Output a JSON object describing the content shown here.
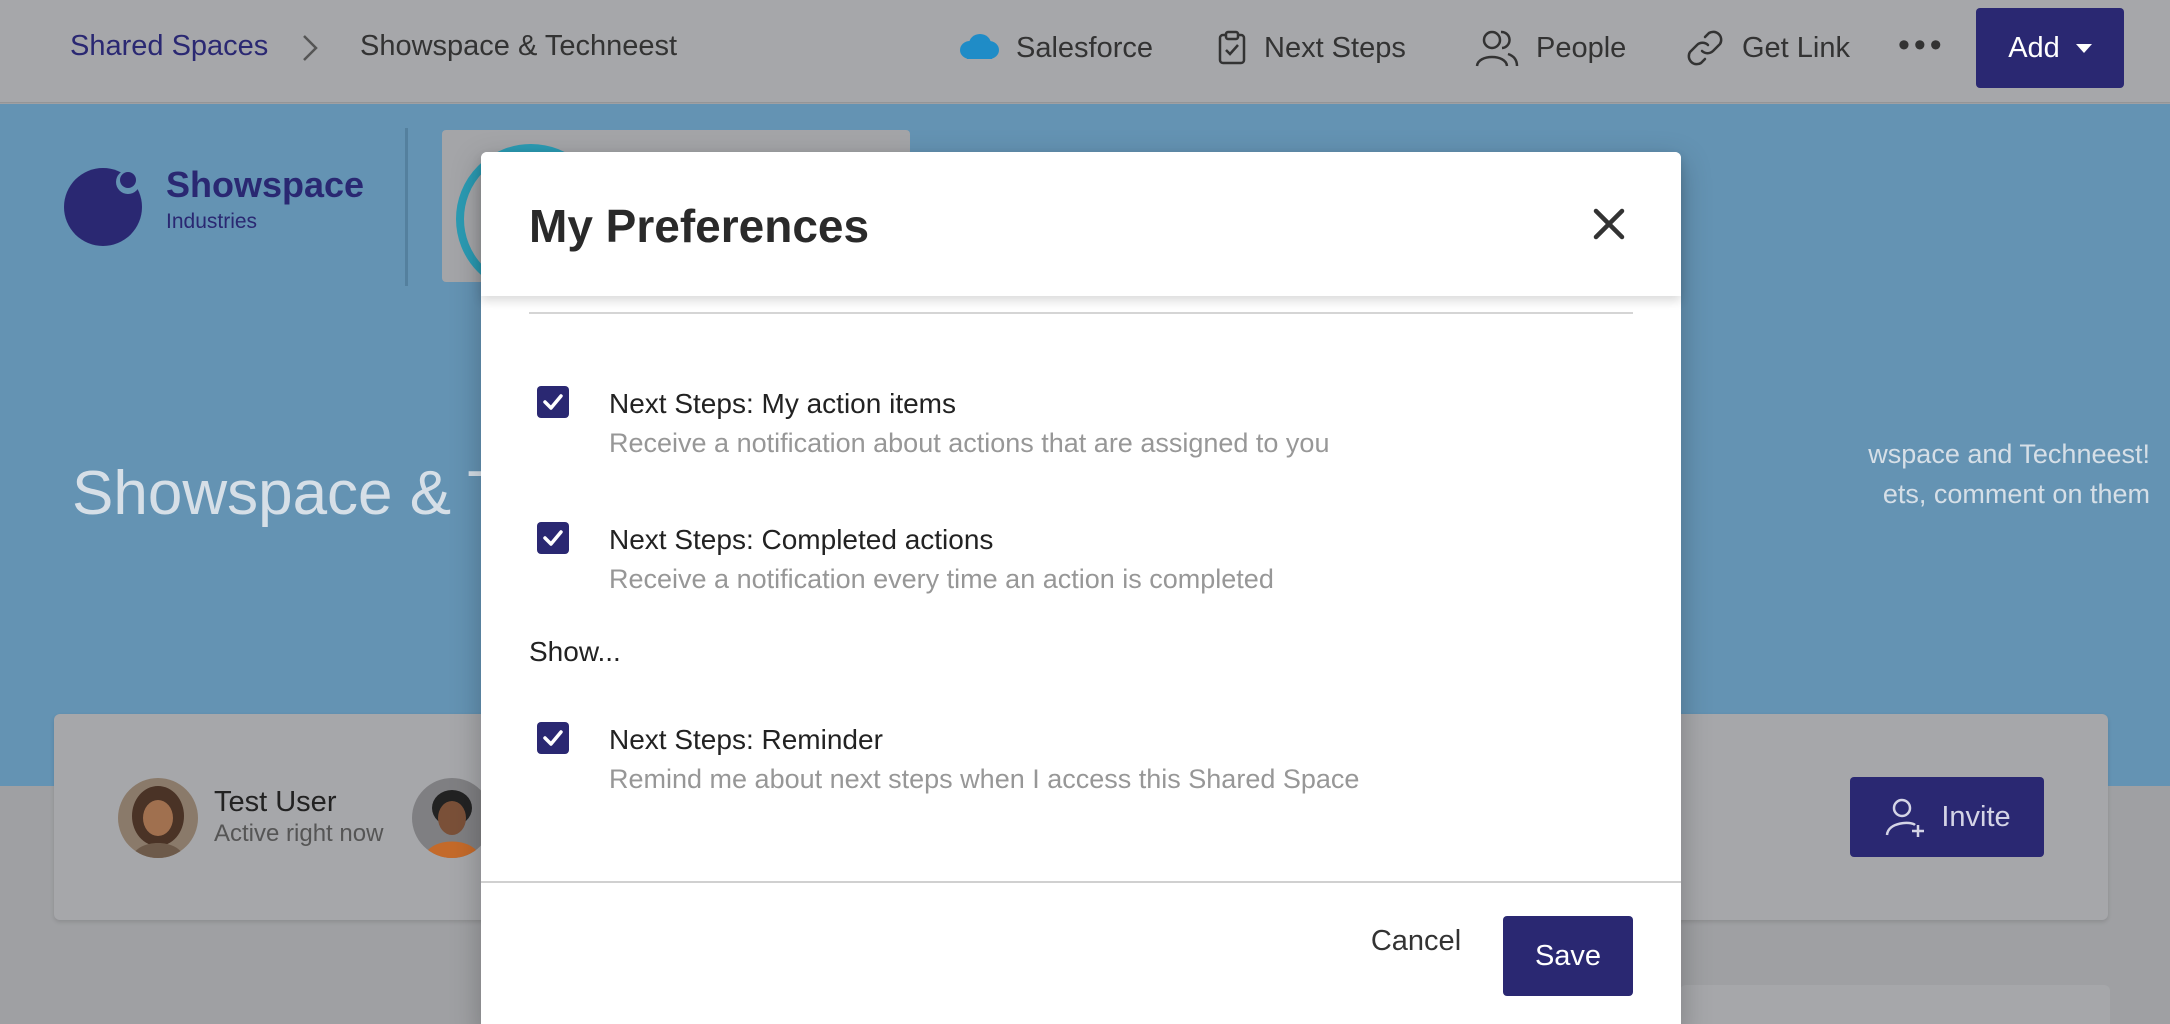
{
  "breadcrumb": {
    "root": "Shared Spaces",
    "current": "Showspace & Techneest"
  },
  "nav": {
    "salesforce": "Salesforce",
    "next_steps": "Next Steps",
    "people": "People",
    "get_link": "Get Link",
    "more": "•••",
    "add": "Add"
  },
  "brand": {
    "name": "Showspace",
    "subtitle": "Industries"
  },
  "hero": {
    "title": "Showspace & T",
    "desc_line1": "wspace and Techneest!",
    "desc_line2": "ets, comment on them"
  },
  "members": {
    "name": "Test User",
    "status": "Active right now",
    "invite": "Invite"
  },
  "modal": {
    "title": "My Preferences",
    "prefs": [
      {
        "title": "Next Steps: My action items",
        "desc": "Receive a notification about actions that are assigned to you",
        "checked": true
      },
      {
        "title": "Next Steps: Completed actions",
        "desc": "Receive a notification every time an action is completed",
        "checked": true
      },
      {
        "title": "Next Steps: Reminder",
        "desc": "Remind me about next steps when I access this Shared Space",
        "checked": true
      }
    ],
    "section_label": "Show...",
    "cancel": "Cancel",
    "save": "Save"
  },
  "colors": {
    "brand": "#2a2872",
    "hero": "#6493b3",
    "overlay_gray": "#a6a7aa",
    "muted_text": "#979797"
  }
}
